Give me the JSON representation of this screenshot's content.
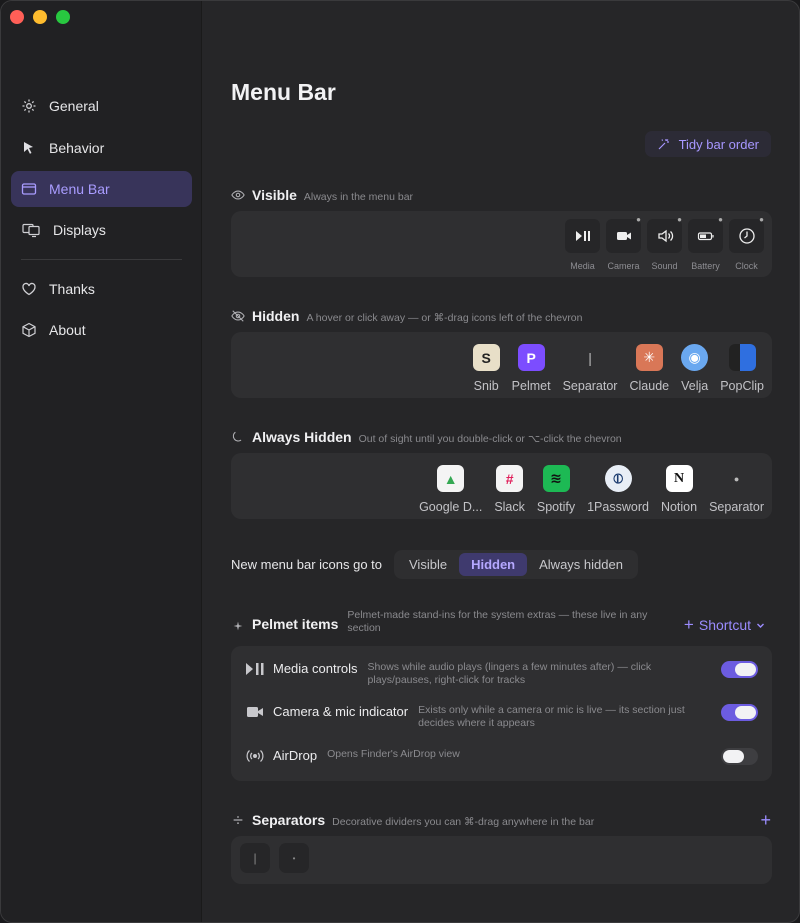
{
  "sidebar": {
    "items": [
      {
        "label": "General",
        "icon": "gear-icon",
        "active": false
      },
      {
        "label": "Behavior",
        "icon": "cursor-icon",
        "active": false
      },
      {
        "label": "Menu Bar",
        "icon": "menubar-icon",
        "active": true
      },
      {
        "label": "Displays",
        "icon": "displays-icon",
        "active": false
      },
      {
        "label": "Thanks",
        "icon": "heart-icon",
        "active": false
      },
      {
        "label": "About",
        "icon": "cube-icon",
        "active": false
      }
    ]
  },
  "main": {
    "title": "Menu Bar",
    "tidy_label": "Tidy bar order",
    "visible": {
      "title": "Visible",
      "desc": "Always in the menu bar",
      "items": [
        {
          "label": "Media",
          "icon": "play-pause-icon"
        },
        {
          "label": "Camera",
          "icon": "camera-icon"
        },
        {
          "label": "Sound",
          "icon": "speaker-icon"
        },
        {
          "label": "Battery",
          "icon": "battery-icon"
        },
        {
          "label": "Clock",
          "icon": "clock-icon"
        }
      ]
    },
    "hidden": {
      "title": "Hidden",
      "desc": "A hover or click away — or ⌘-drag icons left of the chevron",
      "items": [
        {
          "label": "Snib",
          "icon": "snib-app-icon"
        },
        {
          "label": "Pelmet",
          "icon": "pelmet-app-icon"
        },
        {
          "label": "Separator",
          "icon": "separator-bar-icon"
        },
        {
          "label": "Claude",
          "icon": "claude-app-icon"
        },
        {
          "label": "Velja",
          "icon": "velja-app-icon"
        },
        {
          "label": "PopClip",
          "icon": "popclip-app-icon"
        }
      ]
    },
    "always_hidden": {
      "title": "Always Hidden",
      "desc": "Out of sight until you double-click or ⌥-click the chevron",
      "items": [
        {
          "label": "Google D...",
          "icon": "google-drive-app-icon"
        },
        {
          "label": "Slack",
          "icon": "slack-app-icon"
        },
        {
          "label": "Spotify",
          "icon": "spotify-app-icon"
        },
        {
          "label": "1Password",
          "icon": "onepassword-app-icon"
        },
        {
          "label": "Notion",
          "icon": "notion-app-icon"
        },
        {
          "label": "Separator",
          "icon": "separator-dot-icon"
        }
      ]
    },
    "new_icons": {
      "label": "New menu bar icons go to",
      "options": [
        "Visible",
        "Hidden",
        "Always hidden"
      ],
      "selected": "Hidden"
    },
    "pelmet_items": {
      "title": "Pelmet items",
      "desc": "Pelmet-made stand-ins for the system extras — these live in any section",
      "shortcut_label": "Shortcut",
      "rows": [
        {
          "title": "Media controls",
          "desc": "Shows while audio plays (lingers a few minutes after) — click plays/pauses, right-click for tracks",
          "on": true
        },
        {
          "title": "Camera & mic indicator",
          "desc": "Exists only while a camera or mic is live — its section just decides where it appears",
          "on": true
        },
        {
          "title": "AirDrop",
          "desc": "Opens Finder's AirDrop view",
          "on": false
        }
      ]
    },
    "separators": {
      "title": "Separators",
      "desc": "Decorative dividers you can ⌘-drag anywhere in the bar",
      "chips": [
        "|",
        "•"
      ]
    }
  },
  "colors": {
    "accent": "#8b7cf6",
    "active_bg": "#38345a"
  }
}
